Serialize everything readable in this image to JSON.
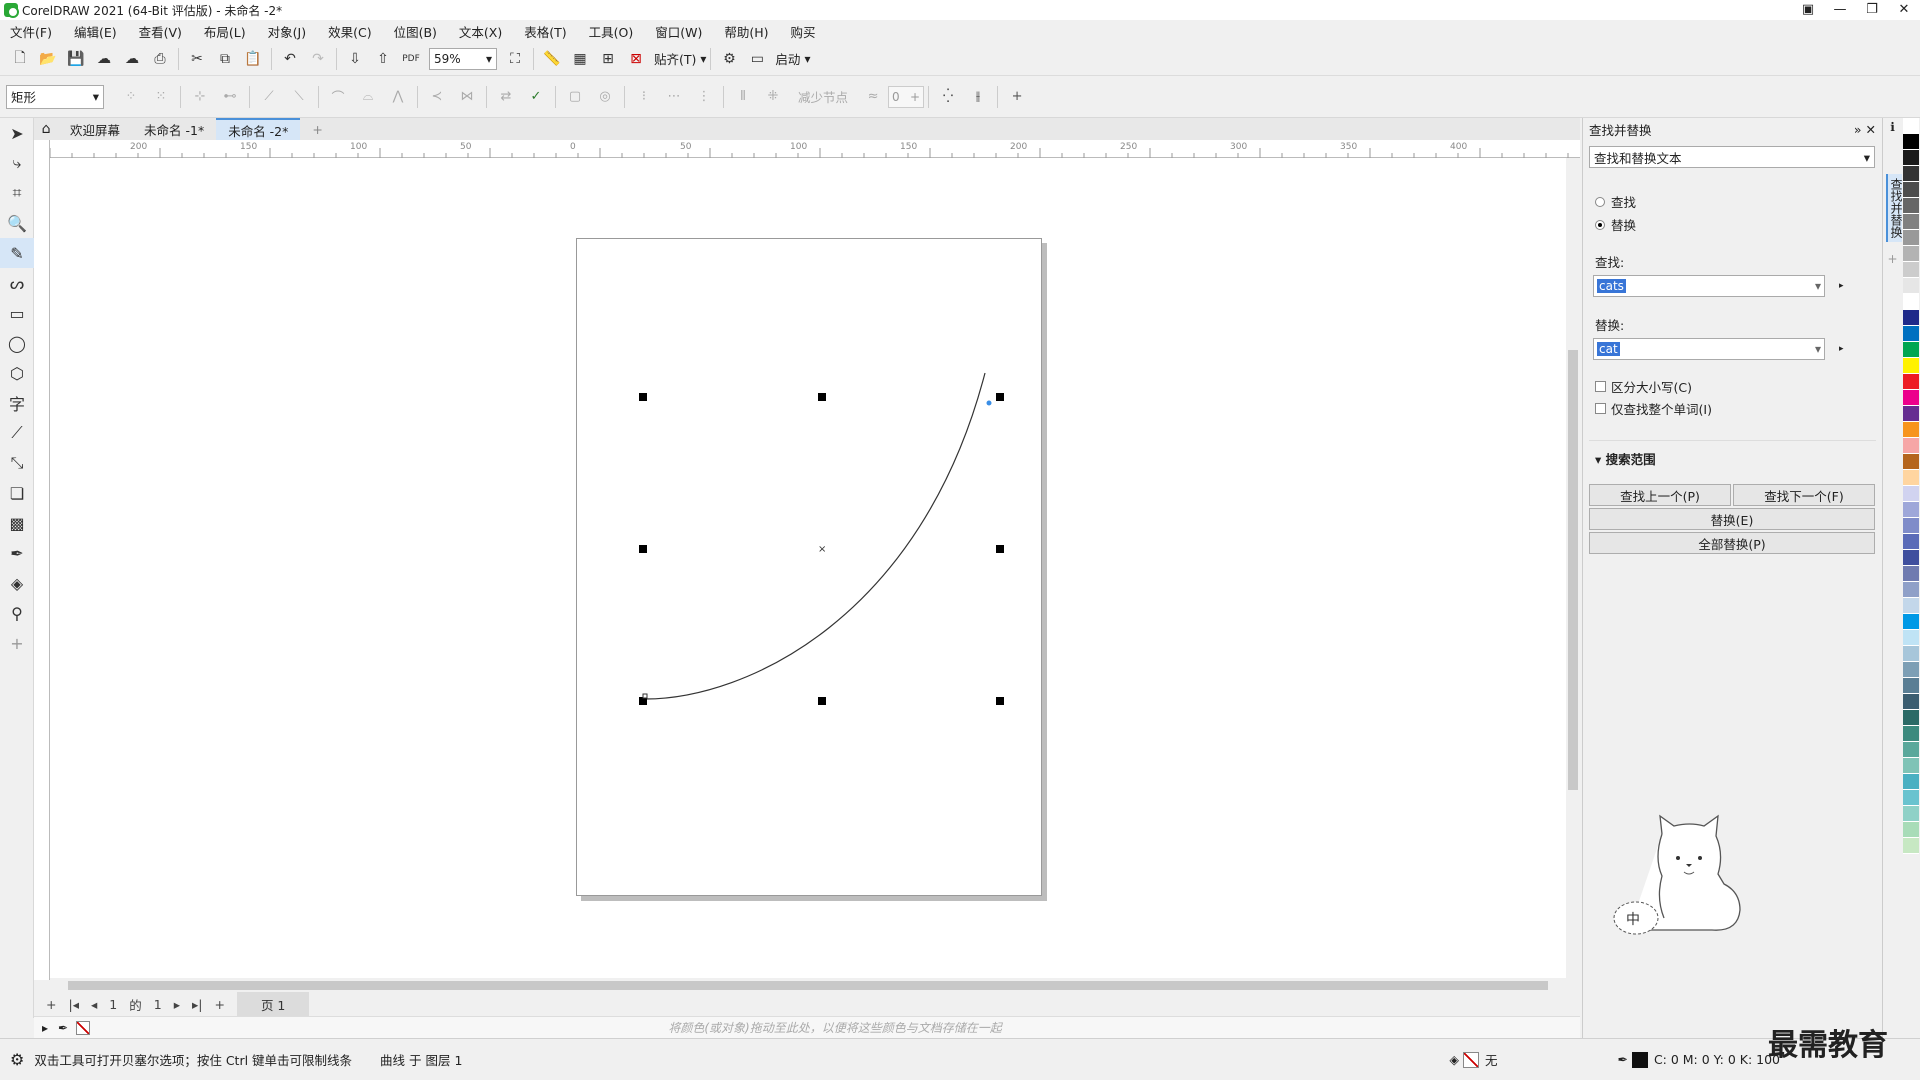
{
  "window": {
    "title": "CorelDRAW 2021 (64-Bit 评估版) - 未命名 -2*"
  },
  "menu": [
    "文件(F)",
    "编辑(E)",
    "查看(V)",
    "布局(L)",
    "对象(J)",
    "效果(C)",
    "位图(B)",
    "文本(X)",
    "表格(T)",
    "工具(O)",
    "窗口(W)",
    "帮助(H)",
    "购买"
  ],
  "toolbar": {
    "zoom": "59%",
    "snap_label": "贴齐(T)",
    "launch_label": "启动"
  },
  "propbar": {
    "shape": "矩形",
    "reduce_nodes": "减少节点",
    "smooth_value": "0"
  },
  "tabs": [
    {
      "label": "欢迎屏幕"
    },
    {
      "label": "未命名 -1*"
    },
    {
      "label": "未命名 -2*"
    }
  ],
  "ruler_h": [
    "200",
    "150",
    "100",
    "50",
    "0",
    "50",
    "100",
    "150",
    "200",
    "250",
    "300",
    "350",
    "400"
  ],
  "pagenav": {
    "current": "1",
    "of": "的",
    "total": "1",
    "page_tab": "页 1"
  },
  "color_hint": "将颜色(或对象)拖动至此处，以便将这些颜色与文档存储在一起",
  "status": {
    "hint": "双击工具可打开贝塞尔选项；按住 Ctrl 键单击可限制线条",
    "object": "曲线 于 图层 1",
    "fill": "无",
    "cmyk": "C:  0 M:  0 Y:  0 K:  100"
  },
  "panel": {
    "title": "查找并替换",
    "mode": "查找和替换文本",
    "radio_find": "查找",
    "radio_replace": "替换",
    "find_label": "查找:",
    "find_value": "cats",
    "replace_label": "替换:",
    "replace_value": "cat",
    "match_case": "区分大小写(C)",
    "whole_word": "仅查找整个单词(I)",
    "scope": "搜索范围",
    "find_prev": "查找上一个(P)",
    "find_next": "查找下一个(F)",
    "replace_btn": "替换(E)",
    "replace_all": "全部替换(P)",
    "side_tab": "查找并替换"
  },
  "mascot_text": "中",
  "watermark": "最需教育",
  "palette": [
    "#ffffff",
    "#000000",
    "#1a1a1a",
    "#333333",
    "#4d4d4d",
    "#666666",
    "#808080",
    "#999999",
    "#b3b3b3",
    "#cccccc",
    "#e6e6e6",
    "#ffffff",
    "#1f2a8a",
    "#0070c0",
    "#00a651",
    "#fff200",
    "#ed1c24",
    "#ec008c",
    "#662d91",
    "#f7941d",
    "#f6a6a6",
    "#b5651d",
    "#ffd5a0",
    "#d1d3f0",
    "#9ea7d9",
    "#7f8cc9",
    "#5a6bb8",
    "#3f4f9e",
    "#6f7bb0",
    "#8fa0c8",
    "#c3d7ea",
    "#0099e6",
    "#bfe3f5",
    "#a7c6da",
    "#7d9fb5",
    "#5a7e94",
    "#3b5d70",
    "#2b6a66",
    "#3c8a7e",
    "#5aa89b",
    "#7fc3b6",
    "#4ab0c2",
    "#69c3cf",
    "#8fd1c7",
    "#a8dcb8",
    "#c7e8c3"
  ]
}
